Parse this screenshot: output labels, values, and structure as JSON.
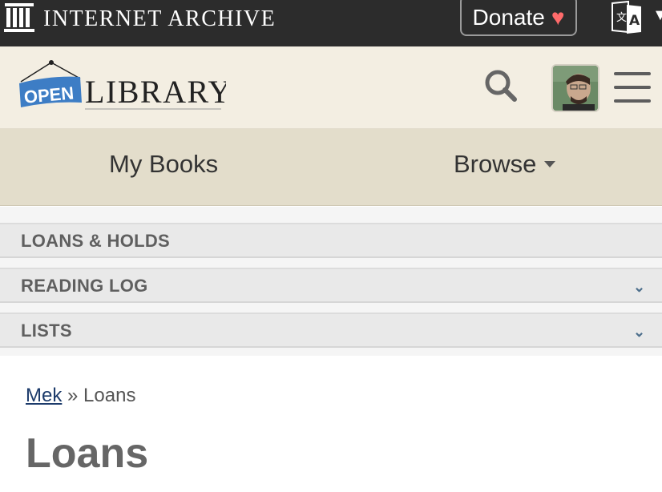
{
  "ia_bar": {
    "title": "INTERNET ARCHIVE",
    "donate_label": "Donate",
    "donate_heart": "♥",
    "lang_caret": "▼",
    "icons": {
      "logo": "ia-building-icon",
      "language": "translate-icon"
    },
    "colors": {
      "background": "#2c2c2c",
      "heart": "#ff6b6b"
    }
  },
  "ol_header": {
    "logo_open": "OPEN",
    "logo_library": "LIBRARY",
    "icons": {
      "search": "search-icon",
      "menu": "hamburger-menu-icon",
      "avatar": "user-avatar"
    },
    "colors": {
      "background": "#f3eee2",
      "logo_blue": "#3d7dc5"
    }
  },
  "nav": {
    "my_books": "My Books",
    "browse": "Browse"
  },
  "accordion": [
    {
      "label": "LOANS & HOLDS",
      "has_chevron": false
    },
    {
      "label": "READING LOG",
      "has_chevron": true,
      "chevron": "⌄"
    },
    {
      "label": "LISTS",
      "has_chevron": true,
      "chevron": "⌄"
    }
  ],
  "breadcrumb": {
    "user_link": "Mek",
    "separator": "»",
    "current": "Loans"
  },
  "page": {
    "title": "Loans"
  }
}
